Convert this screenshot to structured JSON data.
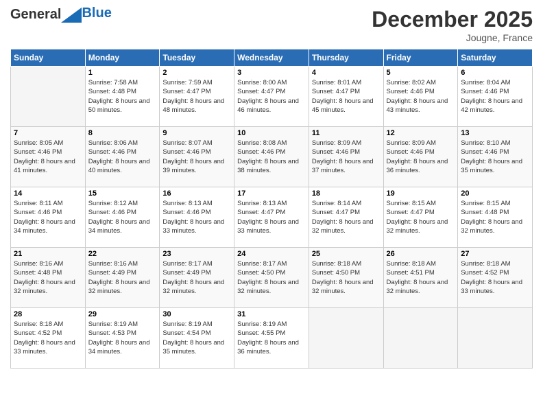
{
  "header": {
    "logo_general": "General",
    "logo_blue": "Blue",
    "month_title": "December 2025",
    "location": "Jougne, France"
  },
  "days_of_week": [
    "Sunday",
    "Monday",
    "Tuesday",
    "Wednesday",
    "Thursday",
    "Friday",
    "Saturday"
  ],
  "weeks": [
    [
      {
        "num": "",
        "sunrise": "",
        "sunset": "",
        "daylight": ""
      },
      {
        "num": "1",
        "sunrise": "Sunrise: 7:58 AM",
        "sunset": "Sunset: 4:48 PM",
        "daylight": "Daylight: 8 hours and 50 minutes."
      },
      {
        "num": "2",
        "sunrise": "Sunrise: 7:59 AM",
        "sunset": "Sunset: 4:47 PM",
        "daylight": "Daylight: 8 hours and 48 minutes."
      },
      {
        "num": "3",
        "sunrise": "Sunrise: 8:00 AM",
        "sunset": "Sunset: 4:47 PM",
        "daylight": "Daylight: 8 hours and 46 minutes."
      },
      {
        "num": "4",
        "sunrise": "Sunrise: 8:01 AM",
        "sunset": "Sunset: 4:47 PM",
        "daylight": "Daylight: 8 hours and 45 minutes."
      },
      {
        "num": "5",
        "sunrise": "Sunrise: 8:02 AM",
        "sunset": "Sunset: 4:46 PM",
        "daylight": "Daylight: 8 hours and 43 minutes."
      },
      {
        "num": "6",
        "sunrise": "Sunrise: 8:04 AM",
        "sunset": "Sunset: 4:46 PM",
        "daylight": "Daylight: 8 hours and 42 minutes."
      }
    ],
    [
      {
        "num": "7",
        "sunrise": "Sunrise: 8:05 AM",
        "sunset": "Sunset: 4:46 PM",
        "daylight": "Daylight: 8 hours and 41 minutes."
      },
      {
        "num": "8",
        "sunrise": "Sunrise: 8:06 AM",
        "sunset": "Sunset: 4:46 PM",
        "daylight": "Daylight: 8 hours and 40 minutes."
      },
      {
        "num": "9",
        "sunrise": "Sunrise: 8:07 AM",
        "sunset": "Sunset: 4:46 PM",
        "daylight": "Daylight: 8 hours and 39 minutes."
      },
      {
        "num": "10",
        "sunrise": "Sunrise: 8:08 AM",
        "sunset": "Sunset: 4:46 PM",
        "daylight": "Daylight: 8 hours and 38 minutes."
      },
      {
        "num": "11",
        "sunrise": "Sunrise: 8:09 AM",
        "sunset": "Sunset: 4:46 PM",
        "daylight": "Daylight: 8 hours and 37 minutes."
      },
      {
        "num": "12",
        "sunrise": "Sunrise: 8:09 AM",
        "sunset": "Sunset: 4:46 PM",
        "daylight": "Daylight: 8 hours and 36 minutes."
      },
      {
        "num": "13",
        "sunrise": "Sunrise: 8:10 AM",
        "sunset": "Sunset: 4:46 PM",
        "daylight": "Daylight: 8 hours and 35 minutes."
      }
    ],
    [
      {
        "num": "14",
        "sunrise": "Sunrise: 8:11 AM",
        "sunset": "Sunset: 4:46 PM",
        "daylight": "Daylight: 8 hours and 34 minutes."
      },
      {
        "num": "15",
        "sunrise": "Sunrise: 8:12 AM",
        "sunset": "Sunset: 4:46 PM",
        "daylight": "Daylight: 8 hours and 34 minutes."
      },
      {
        "num": "16",
        "sunrise": "Sunrise: 8:13 AM",
        "sunset": "Sunset: 4:46 PM",
        "daylight": "Daylight: 8 hours and 33 minutes."
      },
      {
        "num": "17",
        "sunrise": "Sunrise: 8:13 AM",
        "sunset": "Sunset: 4:47 PM",
        "daylight": "Daylight: 8 hours and 33 minutes."
      },
      {
        "num": "18",
        "sunrise": "Sunrise: 8:14 AM",
        "sunset": "Sunset: 4:47 PM",
        "daylight": "Daylight: 8 hours and 32 minutes."
      },
      {
        "num": "19",
        "sunrise": "Sunrise: 8:15 AM",
        "sunset": "Sunset: 4:47 PM",
        "daylight": "Daylight: 8 hours and 32 minutes."
      },
      {
        "num": "20",
        "sunrise": "Sunrise: 8:15 AM",
        "sunset": "Sunset: 4:48 PM",
        "daylight": "Daylight: 8 hours and 32 minutes."
      }
    ],
    [
      {
        "num": "21",
        "sunrise": "Sunrise: 8:16 AM",
        "sunset": "Sunset: 4:48 PM",
        "daylight": "Daylight: 8 hours and 32 minutes."
      },
      {
        "num": "22",
        "sunrise": "Sunrise: 8:16 AM",
        "sunset": "Sunset: 4:49 PM",
        "daylight": "Daylight: 8 hours and 32 minutes."
      },
      {
        "num": "23",
        "sunrise": "Sunrise: 8:17 AM",
        "sunset": "Sunset: 4:49 PM",
        "daylight": "Daylight: 8 hours and 32 minutes."
      },
      {
        "num": "24",
        "sunrise": "Sunrise: 8:17 AM",
        "sunset": "Sunset: 4:50 PM",
        "daylight": "Daylight: 8 hours and 32 minutes."
      },
      {
        "num": "25",
        "sunrise": "Sunrise: 8:18 AM",
        "sunset": "Sunset: 4:50 PM",
        "daylight": "Daylight: 8 hours and 32 minutes."
      },
      {
        "num": "26",
        "sunrise": "Sunrise: 8:18 AM",
        "sunset": "Sunset: 4:51 PM",
        "daylight": "Daylight: 8 hours and 32 minutes."
      },
      {
        "num": "27",
        "sunrise": "Sunrise: 8:18 AM",
        "sunset": "Sunset: 4:52 PM",
        "daylight": "Daylight: 8 hours and 33 minutes."
      }
    ],
    [
      {
        "num": "28",
        "sunrise": "Sunrise: 8:18 AM",
        "sunset": "Sunset: 4:52 PM",
        "daylight": "Daylight: 8 hours and 33 minutes."
      },
      {
        "num": "29",
        "sunrise": "Sunrise: 8:19 AM",
        "sunset": "Sunset: 4:53 PM",
        "daylight": "Daylight: 8 hours and 34 minutes."
      },
      {
        "num": "30",
        "sunrise": "Sunrise: 8:19 AM",
        "sunset": "Sunset: 4:54 PM",
        "daylight": "Daylight: 8 hours and 35 minutes."
      },
      {
        "num": "31",
        "sunrise": "Sunrise: 8:19 AM",
        "sunset": "Sunset: 4:55 PM",
        "daylight": "Daylight: 8 hours and 36 minutes."
      },
      {
        "num": "",
        "sunrise": "",
        "sunset": "",
        "daylight": ""
      },
      {
        "num": "",
        "sunrise": "",
        "sunset": "",
        "daylight": ""
      },
      {
        "num": "",
        "sunrise": "",
        "sunset": "",
        "daylight": ""
      }
    ]
  ]
}
